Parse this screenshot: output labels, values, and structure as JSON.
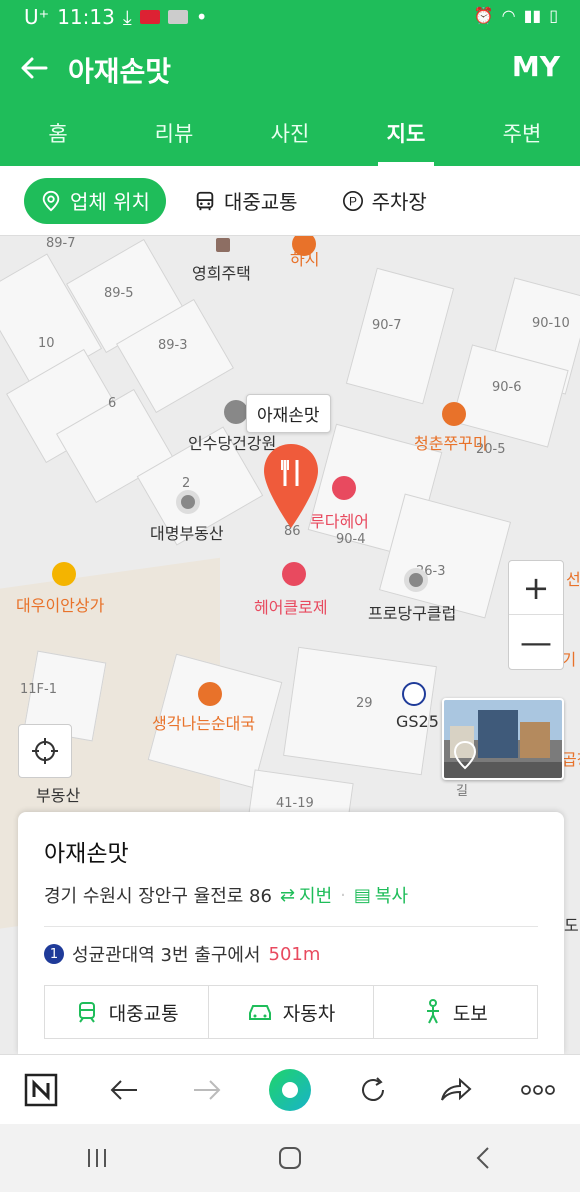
{
  "status_bar": {
    "carrier": "U⁺",
    "time": "11:13"
  },
  "header": {
    "title": "아재손맛",
    "my_label": "MY"
  },
  "tabs": [
    {
      "label": "홈"
    },
    {
      "label": "리뷰"
    },
    {
      "label": "사진"
    },
    {
      "label": "지도",
      "active": true
    },
    {
      "label": "주변"
    }
  ],
  "filters": {
    "location": "업체 위치",
    "transit": "대중교통",
    "parking": "주차장"
  },
  "map": {
    "tooltip": "아재손맛",
    "lot_labels": [
      "89-7",
      "89-5",
      "89-3",
      "10",
      "6",
      "90-7",
      "90-10",
      "90-6",
      "20-5",
      "2",
      "86",
      "90-4",
      "26-3",
      "11F-1",
      "29",
      "41-19",
      "길"
    ],
    "pois": {
      "hasi": "하시",
      "younghee": "영희주택",
      "insudang": "인수당건강원",
      "daemyung": "대명부동산",
      "chungchun": "청춘쭈꾸미",
      "ruda": "루다헤어",
      "daewooi": "대우이안상가",
      "hair_clo": "헤어클로제",
      "proDang": "프로당구클럽",
      "saenggak": "생각나는순대국",
      "gs25": "GS25",
      "busan_left": "부동산",
      "right_edge_1": "선",
      "right_edge_2": "이야기",
      "right_edge_3": "곱창",
      "right_edge_4": "도"
    },
    "zoom_in": "+",
    "zoom_out": "—"
  },
  "place": {
    "name": "아재손맛",
    "address": "경기 수원시 장안구 율전로 86",
    "jibun_label": "지번",
    "copy_label": "복사",
    "subway_line": "1",
    "subway_text": "성균관대역 3번 출구에서",
    "distance": "501m",
    "route_transit": "대중교통",
    "route_car": "자동차",
    "route_walk": "도보"
  },
  "colors": {
    "brand_green": "#1fbd5a",
    "accent_red": "#e84a5f",
    "poi_orange": "#e8722a"
  }
}
